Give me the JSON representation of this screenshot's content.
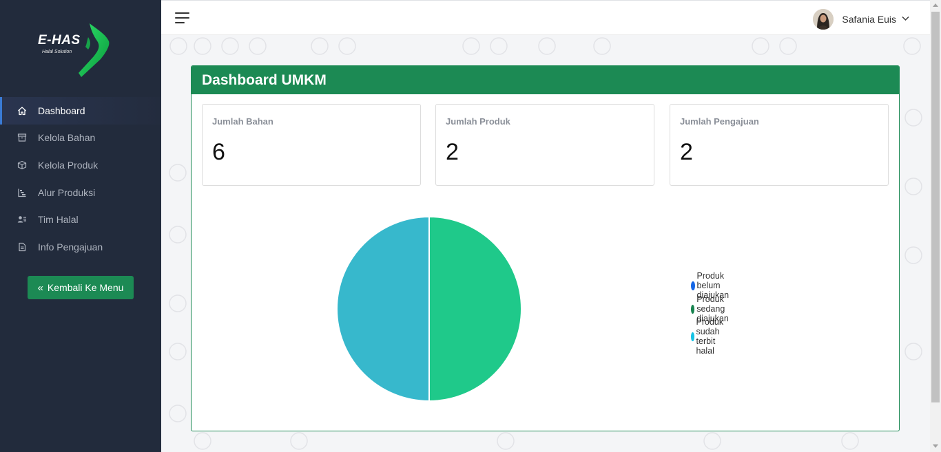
{
  "app": {
    "logo_text": "E-HAS",
    "logo_subtitle": "Halal Solution"
  },
  "sidebar": {
    "items": [
      {
        "label": "Dashboard",
        "icon": "home-icon",
        "active": true
      },
      {
        "label": "Kelola Bahan",
        "icon": "archive-icon",
        "active": false
      },
      {
        "label": "Kelola Produk",
        "icon": "box-icon",
        "active": false
      },
      {
        "label": "Alur Produksi",
        "icon": "flow-icon",
        "active": false
      },
      {
        "label": "Tim Halal",
        "icon": "team-icon",
        "active": false
      },
      {
        "label": "Info Pengajuan",
        "icon": "document-icon",
        "active": false
      }
    ],
    "back_button": "Kembali Ke Menu"
  },
  "topbar": {
    "user_name": "Safania Euis"
  },
  "card": {
    "title": "Dashboard UMKM",
    "stats": [
      {
        "label": "Jumlah Bahan",
        "value": "6"
      },
      {
        "label": "Jumlah Produk",
        "value": "2"
      },
      {
        "label": "Jumlah Pengajuan",
        "value": "2"
      }
    ]
  },
  "colors": {
    "sidebar_bg": "#222b3c",
    "brand_green": "#1c8a54",
    "slice_sedang": "#1fc98a",
    "slice_sudah": "#37b8cc"
  },
  "chart_data": {
    "type": "pie",
    "categories": [
      "Produk belum diajukan",
      "Produk sedang diajukan",
      "Produk sudah terbit halal"
    ],
    "values": [
      0,
      1,
      1
    ],
    "legend_colors": [
      "#1366e6",
      "#17834f",
      "#14c2e4"
    ],
    "slice_colors": [
      "#1366e6",
      "#1fc98a",
      "#37b8cc"
    ],
    "legend_position": "right"
  }
}
